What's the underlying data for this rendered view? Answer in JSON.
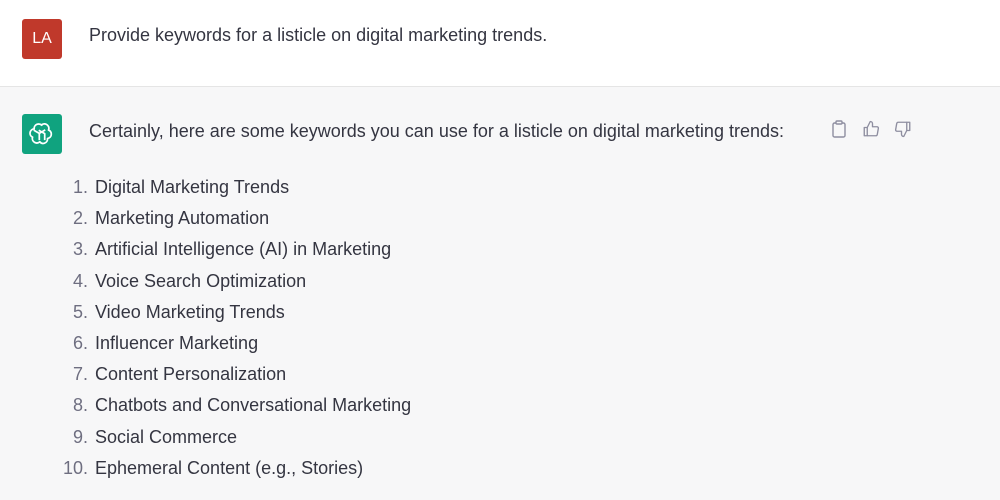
{
  "colors": {
    "user_avatar_bg": "#c0392b",
    "bot_avatar_bg": "#10a37f",
    "page_bg": "#f7f7f8",
    "text": "#343541"
  },
  "user": {
    "avatar_initials": "LA",
    "message": "Provide keywords for a listicle on digital marketing trends."
  },
  "assistant": {
    "avatar_icon": "openai-logo-icon",
    "intro": "Certainly, here are some keywords you can use for a listicle on digital marketing trends:",
    "actions": [
      {
        "name": "copy-icon"
      },
      {
        "name": "thumbs-up-icon"
      },
      {
        "name": "thumbs-down-icon"
      }
    ],
    "keywords": [
      {
        "num": "1.",
        "text": "Digital Marketing Trends"
      },
      {
        "num": "2.",
        "text": "Marketing Automation"
      },
      {
        "num": "3.",
        "text": "Artificial Intelligence (AI) in Marketing"
      },
      {
        "num": "4.",
        "text": "Voice Search Optimization"
      },
      {
        "num": "5.",
        "text": "Video Marketing Trends"
      },
      {
        "num": "6.",
        "text": "Influencer Marketing"
      },
      {
        "num": "7.",
        "text": "Content Personalization"
      },
      {
        "num": "8.",
        "text": "Chatbots and Conversational Marketing"
      },
      {
        "num": "9.",
        "text": "Social Commerce"
      },
      {
        "num": "10.",
        "text": "Ephemeral Content (e.g., Stories)"
      }
    ]
  }
}
